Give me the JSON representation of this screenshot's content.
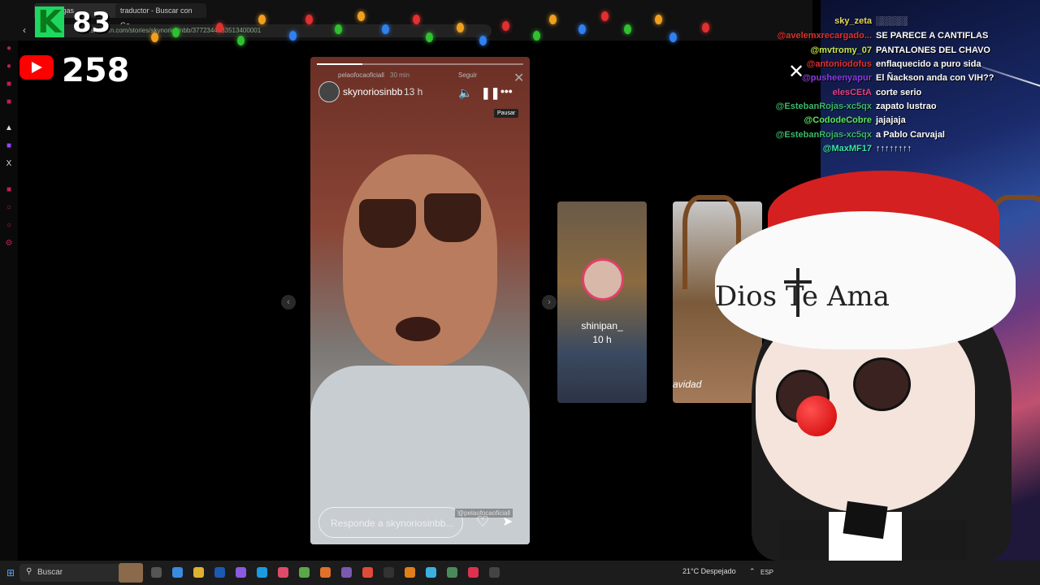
{
  "browser": {
    "tabs": [
      {
        "label": "Descargas"
      },
      {
        "label": "traductor - Buscar con Go"
      }
    ],
    "url": "instagram.com/stories/skynoriosinbb/3772344233513400001"
  },
  "counters": {
    "kick_count": "83",
    "kick_letter": "K",
    "youtube_count": "258"
  },
  "story": {
    "username": "skynoriosinbb",
    "time": "13 h",
    "sub_username": "pelaofocaoficiall",
    "sub_time": "30 min",
    "follow_label": "Seguir",
    "pause_tooltip": "Pausar",
    "reply_placeholder": "Responde a skynoriosinbb...",
    "mention_tag": "@pelaofocaoficiall",
    "progress_fraction": 0.22
  },
  "next_stories": [
    {
      "username": "shinipan_",
      "time": "10 h"
    },
    {
      "caption": "avidad"
    }
  ],
  "chat": [
    {
      "name": "sky_zeta",
      "message": "░░░░░",
      "name_color": "#e8d85a"
    },
    {
      "name": "@avelemxrecargado...",
      "message": "SE PARECE A CANTIFLAS",
      "name_color": "#e03030"
    },
    {
      "name": "@mvtromy_07",
      "message": "PANTALONES DEL CHAVO",
      "name_color": "#c8e84a"
    },
    {
      "name": "@antoniodofus",
      "message": "enflaquecido a puro sida",
      "name_color": "#e03030"
    },
    {
      "name": "@pusheenyapur",
      "message": "El Ñackson anda con VIH??",
      "name_color": "#8a3ae8"
    },
    {
      "name": "elesCEtA",
      "message": "corte serio",
      "name_color": "#e8408a"
    },
    {
      "name": "@EstebanRojas-xc5qx",
      "message": "zapato lustrao",
      "name_color": "#3ab86a"
    },
    {
      "name": "@CododeCobre",
      "message": "jajajaja",
      "name_color": "#5ae85a"
    },
    {
      "name": "@EstebanRojas-xc5qx",
      "message": "a Pablo Carvajal",
      "name_color": "#3ab86a"
    },
    {
      "name": "@MaxMF17",
      "message": "↑↑↑↑↑↑↑↑",
      "name_color": "#3ae8a8"
    }
  ],
  "overlay": {
    "banner_text": "Dios Te Ama"
  },
  "taskbar": {
    "search_placeholder": "Buscar",
    "weather": "21°C  Despejado",
    "language": "ESP"
  },
  "colors": {
    "youtube_red": "#ff0000",
    "kick_green": "#1ed760",
    "story_ring": "#e0406a"
  },
  "icons": [
    "volume-icon",
    "pause-icon",
    "more-icon",
    "close-icon",
    "heart-icon",
    "send-icon",
    "chevron-left-icon",
    "chevron-right-icon",
    "windows-icon",
    "search-icon",
    "weather-icon"
  ]
}
